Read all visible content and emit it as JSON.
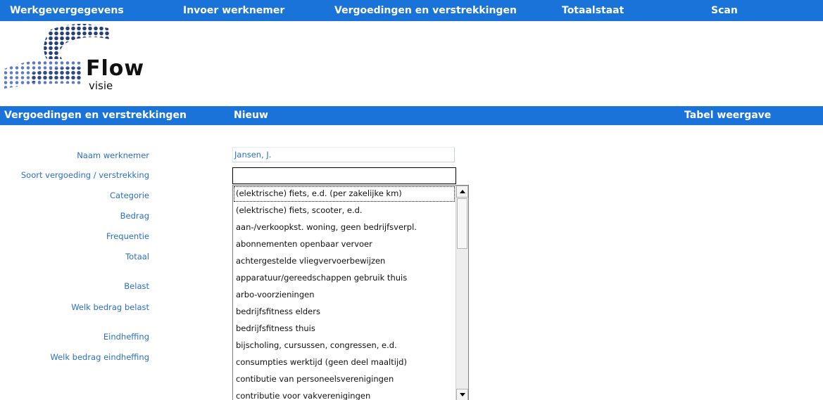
{
  "topnav": {
    "items": [
      {
        "label": "Werkgevergegevens"
      },
      {
        "label": "Invoer werknemer"
      },
      {
        "label": "Vergoedingen en verstrekkingen"
      },
      {
        "label": "Totaalstaat"
      },
      {
        "label": "Scan"
      }
    ]
  },
  "logo": {
    "word": "Flow",
    "subword": "visie"
  },
  "sectionbar": {
    "title": "Vergoedingen en verstrekkingen",
    "new_label": "Nieuw",
    "table_view_label": "Tabel weergave"
  },
  "form": {
    "labels": {
      "naam": "Naam werknemer",
      "soort": "Soort vergoeding / verstrekking",
      "categorie": "Categorie",
      "bedrag": "Bedrag",
      "frequentie": "Frequentie",
      "totaal": "Totaal",
      "belast": "Belast",
      "welk_belast": "Welk bedrag belast",
      "eindheffing": "Eindheffing",
      "welk_eindheffing": "Welk bedrag eindheffing"
    },
    "naam_value": "Jansen, J.",
    "soort_value": ""
  },
  "dropdown": {
    "options": [
      "(elektrische) fiets, e.d. (per zakelijke km)",
      "(elektrische) fiets, scooter, e.d.",
      "aan-/verkoopkst. woning, geen bedrijfsverpl.",
      "abonnementen openbaar vervoer",
      "achtergestelde vliegvervoerbewijzen",
      "apparatuur/gereedschappen gebruik thuis",
      "arbo-voorzieningen",
      "bedrijfsfitness elders",
      "bedrijfsfitness thuis",
      "bijscholing, cursussen, congressen, e.d.",
      "consumpties werktijd (geen deel maaltijd)",
      "contibutie van personeelsverenigingen",
      "contributie voor vakverenigingen"
    ],
    "selected_index": 0
  },
  "colors": {
    "accent": "#1a73d9",
    "label": "#2a6fc6"
  }
}
